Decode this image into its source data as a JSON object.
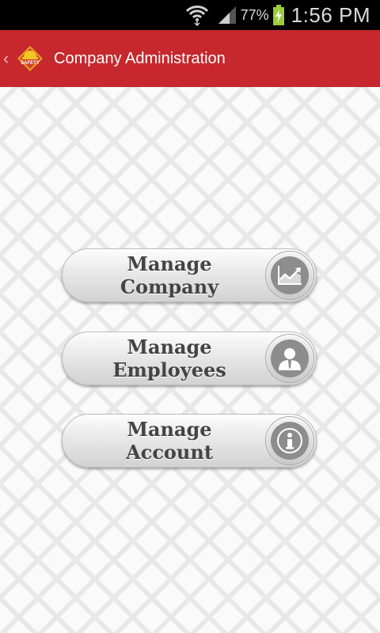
{
  "status_bar": {
    "battery_percent": "77%",
    "time": "1:56 PM"
  },
  "action_bar": {
    "title": "Company Administration",
    "logo_text": "SAFETY"
  },
  "menu": [
    {
      "line1": "Manage",
      "line2": "Company",
      "icon": "chart-icon"
    },
    {
      "line1": "Manage",
      "line2": "Employees",
      "icon": "person-icon"
    },
    {
      "line1": "Manage",
      "line2": "Account",
      "icon": "info-icon"
    }
  ],
  "colors": {
    "action_bar": "#c6282d",
    "status_bar": "#000000"
  }
}
